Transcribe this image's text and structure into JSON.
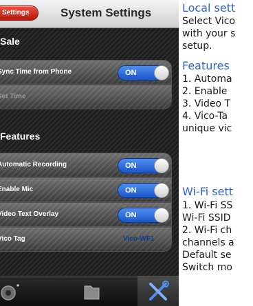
{
  "app": {
    "nav": {
      "back_label": "Settings",
      "title": "System Settings"
    },
    "sections": [
      {
        "header": "Sale",
        "rows": [
          {
            "label": "Sync Time from Phone",
            "toggle": "ON"
          },
          {
            "label": "Set Time"
          }
        ]
      },
      {
        "header": "Features",
        "rows": [
          {
            "label": "Automatic Recording",
            "toggle": "ON"
          },
          {
            "label": "Enable Mic",
            "toggle": "ON"
          },
          {
            "label": "Video Text Overlay",
            "toggle": "ON"
          },
          {
            "label": "Vico Tag",
            "value": "Vico-WF1"
          }
        ]
      }
    ],
    "tabs": [
      {
        "icon": "camera-icon"
      },
      {
        "icon": "folder-icon"
      },
      {
        "icon": "settings-tools-icon"
      }
    ]
  },
  "description": {
    "local": {
      "title": "Local sett",
      "lines": [
        "Select Vico",
        "with your s",
        "setup."
      ]
    },
    "features": {
      "title": "Features",
      "lines": [
        "1. Automa",
        "2. Enable",
        "3. Video T",
        "4. Vico-Ta",
        "unique vic"
      ]
    },
    "wifi": {
      "title": "Wi-Fi sett",
      "lines": [
        "1. Wi-Fi SS",
        "Wi-Fi SSID",
        "2. Wi-Fi ch",
        "channels a",
        "Default se",
        "Switch mo"
      ]
    }
  },
  "colors": {
    "toggle_on": "#2f6fe0",
    "back_button": "#d8301f",
    "title_blue": "#2e64c8",
    "value_blue": "#0f3e96"
  }
}
